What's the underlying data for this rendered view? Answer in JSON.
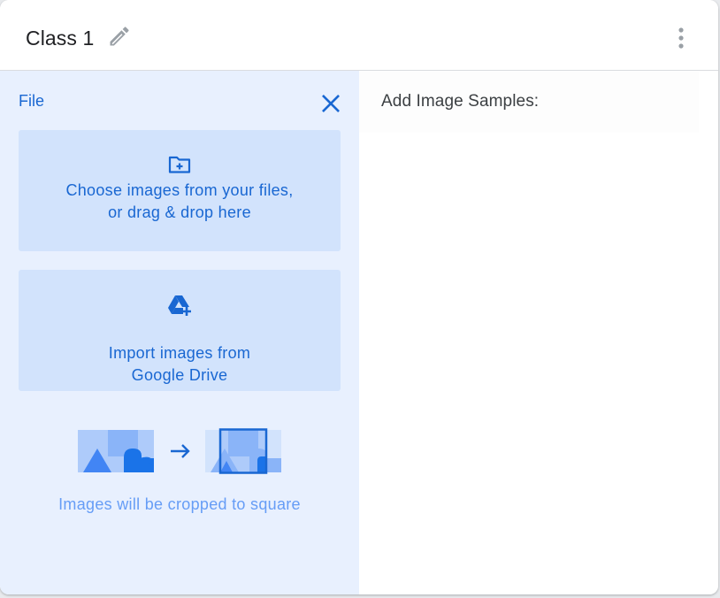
{
  "header": {
    "class_name": "Class 1",
    "edit_icon": "pencil-icon",
    "more_icon": "more-vert-icon"
  },
  "upload_panel": {
    "title": "File",
    "close_icon": "close-icon",
    "files_option": {
      "icon": "folder-add-icon",
      "line1": "Choose images from your files,",
      "line2": "or drag & drop here"
    },
    "drive_option": {
      "icon": "google-drive-add-icon",
      "line1": "Import images from",
      "line2": "Google Drive"
    },
    "crop_note": "Images will be cropped to square"
  },
  "samples": {
    "label": "Add Image Samples:"
  },
  "colors": {
    "accent": "#1967d2",
    "panel_bg": "#e8f0fe",
    "option_bg": "#d2e3fc",
    "muted_accent": "#669df6"
  }
}
